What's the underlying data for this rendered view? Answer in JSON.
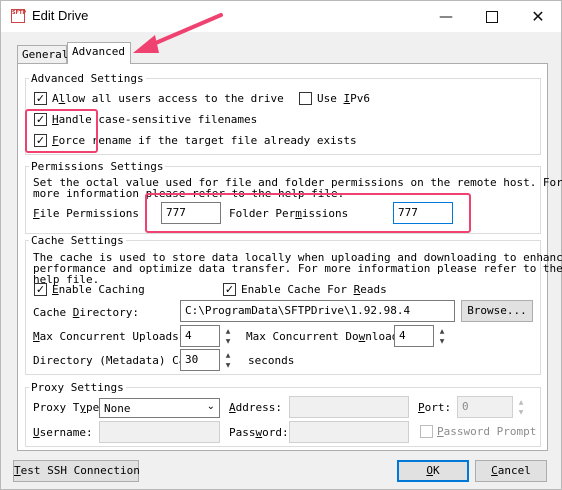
{
  "window": {
    "title": "Edit Drive",
    "app_icon_text": "SFTP",
    "icons": {
      "minimize": "minimize-icon",
      "maximize": "maximize-icon",
      "close": "close-icon",
      "app": "sftp-drive-app-icon"
    }
  },
  "tabs": [
    {
      "label": "General",
      "active": false
    },
    {
      "label": "Advanced",
      "active": true
    }
  ],
  "advanced_settings": {
    "title": "Advanced Settings",
    "allow_all_users": {
      "prefix": "A",
      "hotkey": "l",
      "rest": "low all users access to the drive",
      "checked": true
    },
    "use_ipv6": {
      "prefix": "Use ",
      "hotkey": "I",
      "rest": "Pv6",
      "checked": false
    },
    "handle_case": {
      "prefix": "",
      "hotkey": "H",
      "rest": "andle case-sensitive filenames",
      "checked": true
    },
    "force_rename": {
      "prefix": "",
      "hotkey": "F",
      "rest": "orce rename if the target file already exists",
      "checked": true
    }
  },
  "permissions": {
    "title": "Permissions Settings",
    "desc_line1": "Set the octal value used for file and folder permissions on the remote host. For",
    "desc_line2": "more information please refer to the help file.",
    "file_label": {
      "prefix": "",
      "hotkey": "F",
      "rest": "ile Permissions"
    },
    "file_value": "777",
    "folder_label": {
      "prefix": "Folder Per",
      "hotkey": "m",
      "rest": "issions"
    },
    "folder_value": "777"
  },
  "cache": {
    "title": "Cache Settings",
    "desc_line1": "The cache is used to store data locally when uploading and downloading to enhance",
    "desc_line2": "performance and optimize data transfer. For more information please refer to the",
    "desc_line3": "help file.",
    "enable_caching": {
      "prefix": "",
      "hotkey": "E",
      "rest": "nable Caching",
      "checked": true
    },
    "enable_cache_reads": {
      "prefix": "Enable Cache For ",
      "hotkey": "R",
      "rest": "eads",
      "checked": true
    },
    "directory_label": {
      "prefix": "Cache ",
      "hotkey": "D",
      "rest": "irectory:"
    },
    "directory_value": "C:\\ProgramData\\SFTPDrive\\1.92.98.4",
    "browse_label": "Browse...",
    "max_uploads_label": {
      "prefix": "",
      "hotkey": "M",
      "rest": "ax Concurrent Uploads:"
    },
    "max_uploads_value": "4",
    "max_downloads_label": {
      "prefix": "Max Concurrent Do",
      "hotkey": "w",
      "rest": "nloads:"
    },
    "max_downloads_value": "4",
    "metadata_label": "Directory (Metadata) Cach",
    "metadata_value": "30",
    "seconds_label": "seconds"
  },
  "proxy": {
    "title": "Proxy Settings",
    "type_label": {
      "prefix": "Proxy T",
      "hotkey": "y",
      "rest": "pe:"
    },
    "type_value": "None",
    "address_label": {
      "prefix": "",
      "hotkey": "A",
      "rest": "ddress:"
    },
    "address_value": "",
    "port_label": {
      "prefix": "",
      "hotkey": "P",
      "rest": "ort:"
    },
    "port_value": "0",
    "username_label": {
      "prefix": "",
      "hotkey": "U",
      "rest": "sername:"
    },
    "username_value": "",
    "password_label": {
      "prefix": "Pass",
      "hotkey": "w",
      "rest": "ord:"
    },
    "password_value": "",
    "password_prompt": {
      "prefix": "",
      "hotkey": "P",
      "rest": "assword Prompt",
      "checked": false
    }
  },
  "footer": {
    "test_ssh": {
      "prefix": "",
      "hotkey": "T",
      "rest": "est SSH Connection"
    },
    "ok": {
      "prefix": "",
      "hotkey": "O",
      "rest": "K"
    },
    "cancel": {
      "prefix": "",
      "hotkey": "C",
      "rest": "ancel"
    }
  },
  "annotation": {
    "color": "#ef4270",
    "icon": "red-arrow-icon"
  }
}
